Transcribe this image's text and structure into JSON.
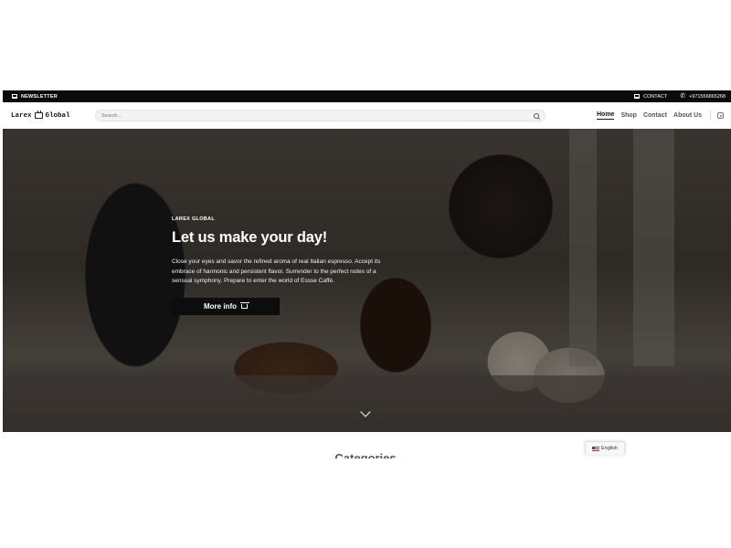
{
  "topbar": {
    "newsletter_label": "NEWSLETTER",
    "contact_label": "CONTACT",
    "phone": "+971556865268"
  },
  "header": {
    "logo_left": "Larex",
    "logo_right": "Global",
    "search_placeholder": "Search...",
    "nav": [
      {
        "label": "Home",
        "active": true
      },
      {
        "label": "Shop",
        "active": false
      },
      {
        "label": "Contact",
        "active": false
      },
      {
        "label": "About Us",
        "active": false
      }
    ],
    "icons": [
      "search-icon",
      "instagram-icon",
      "mail-icon",
      "phone-icon"
    ]
  },
  "hero": {
    "eyebrow": "LAREX GLOBAL",
    "title": "Let us make your day!",
    "body": "Close your eyes and savor the refined aroma of real Italian espresso. Accept its embrace of harmonic and persistent flavor. Surrender to the perfect notes of a sensual symphony. Prepare to enter the world of Essse Caffè.",
    "button_label": "More info"
  },
  "section": {
    "categories_title": "Categories"
  },
  "language": {
    "selected": "English"
  }
}
